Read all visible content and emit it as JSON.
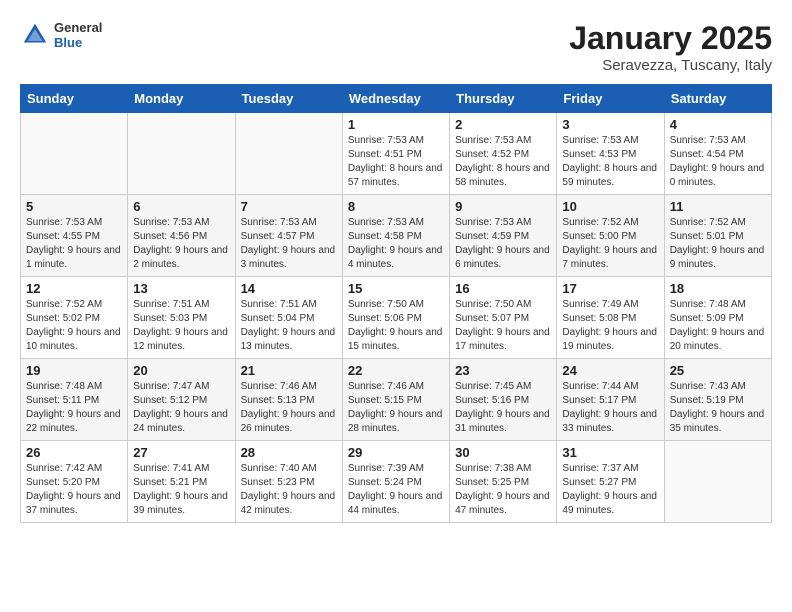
{
  "header": {
    "logo": {
      "general": "General",
      "blue": "Blue"
    },
    "title": "January 2025",
    "location": "Seravezza, Tuscany, Italy"
  },
  "weekdays": [
    "Sunday",
    "Monday",
    "Tuesday",
    "Wednesday",
    "Thursday",
    "Friday",
    "Saturday"
  ],
  "weeks": [
    [
      {
        "day": "",
        "info": ""
      },
      {
        "day": "",
        "info": ""
      },
      {
        "day": "",
        "info": ""
      },
      {
        "day": "1",
        "info": "Sunrise: 7:53 AM\nSunset: 4:51 PM\nDaylight: 8 hours\nand 57 minutes."
      },
      {
        "day": "2",
        "info": "Sunrise: 7:53 AM\nSunset: 4:52 PM\nDaylight: 8 hours\nand 58 minutes."
      },
      {
        "day": "3",
        "info": "Sunrise: 7:53 AM\nSunset: 4:53 PM\nDaylight: 8 hours\nand 59 minutes."
      },
      {
        "day": "4",
        "info": "Sunrise: 7:53 AM\nSunset: 4:54 PM\nDaylight: 9 hours\nand 0 minutes."
      }
    ],
    [
      {
        "day": "5",
        "info": "Sunrise: 7:53 AM\nSunset: 4:55 PM\nDaylight: 9 hours\nand 1 minute."
      },
      {
        "day": "6",
        "info": "Sunrise: 7:53 AM\nSunset: 4:56 PM\nDaylight: 9 hours\nand 2 minutes."
      },
      {
        "day": "7",
        "info": "Sunrise: 7:53 AM\nSunset: 4:57 PM\nDaylight: 9 hours\nand 3 minutes."
      },
      {
        "day": "8",
        "info": "Sunrise: 7:53 AM\nSunset: 4:58 PM\nDaylight: 9 hours\nand 4 minutes."
      },
      {
        "day": "9",
        "info": "Sunrise: 7:53 AM\nSunset: 4:59 PM\nDaylight: 9 hours\nand 6 minutes."
      },
      {
        "day": "10",
        "info": "Sunrise: 7:52 AM\nSunset: 5:00 PM\nDaylight: 9 hours\nand 7 minutes."
      },
      {
        "day": "11",
        "info": "Sunrise: 7:52 AM\nSunset: 5:01 PM\nDaylight: 9 hours\nand 9 minutes."
      }
    ],
    [
      {
        "day": "12",
        "info": "Sunrise: 7:52 AM\nSunset: 5:02 PM\nDaylight: 9 hours\nand 10 minutes."
      },
      {
        "day": "13",
        "info": "Sunrise: 7:51 AM\nSunset: 5:03 PM\nDaylight: 9 hours\nand 12 minutes."
      },
      {
        "day": "14",
        "info": "Sunrise: 7:51 AM\nSunset: 5:04 PM\nDaylight: 9 hours\nand 13 minutes."
      },
      {
        "day": "15",
        "info": "Sunrise: 7:50 AM\nSunset: 5:06 PM\nDaylight: 9 hours\nand 15 minutes."
      },
      {
        "day": "16",
        "info": "Sunrise: 7:50 AM\nSunset: 5:07 PM\nDaylight: 9 hours\nand 17 minutes."
      },
      {
        "day": "17",
        "info": "Sunrise: 7:49 AM\nSunset: 5:08 PM\nDaylight: 9 hours\nand 19 minutes."
      },
      {
        "day": "18",
        "info": "Sunrise: 7:48 AM\nSunset: 5:09 PM\nDaylight: 9 hours\nand 20 minutes."
      }
    ],
    [
      {
        "day": "19",
        "info": "Sunrise: 7:48 AM\nSunset: 5:11 PM\nDaylight: 9 hours\nand 22 minutes."
      },
      {
        "day": "20",
        "info": "Sunrise: 7:47 AM\nSunset: 5:12 PM\nDaylight: 9 hours\nand 24 minutes."
      },
      {
        "day": "21",
        "info": "Sunrise: 7:46 AM\nSunset: 5:13 PM\nDaylight: 9 hours\nand 26 minutes."
      },
      {
        "day": "22",
        "info": "Sunrise: 7:46 AM\nSunset: 5:15 PM\nDaylight: 9 hours\nand 28 minutes."
      },
      {
        "day": "23",
        "info": "Sunrise: 7:45 AM\nSunset: 5:16 PM\nDaylight: 9 hours\nand 31 minutes."
      },
      {
        "day": "24",
        "info": "Sunrise: 7:44 AM\nSunset: 5:17 PM\nDaylight: 9 hours\nand 33 minutes."
      },
      {
        "day": "25",
        "info": "Sunrise: 7:43 AM\nSunset: 5:19 PM\nDaylight: 9 hours\nand 35 minutes."
      }
    ],
    [
      {
        "day": "26",
        "info": "Sunrise: 7:42 AM\nSunset: 5:20 PM\nDaylight: 9 hours\nand 37 minutes."
      },
      {
        "day": "27",
        "info": "Sunrise: 7:41 AM\nSunset: 5:21 PM\nDaylight: 9 hours\nand 39 minutes."
      },
      {
        "day": "28",
        "info": "Sunrise: 7:40 AM\nSunset: 5:23 PM\nDaylight: 9 hours\nand 42 minutes."
      },
      {
        "day": "29",
        "info": "Sunrise: 7:39 AM\nSunset: 5:24 PM\nDaylight: 9 hours\nand 44 minutes."
      },
      {
        "day": "30",
        "info": "Sunrise: 7:38 AM\nSunset: 5:25 PM\nDaylight: 9 hours\nand 47 minutes."
      },
      {
        "day": "31",
        "info": "Sunrise: 7:37 AM\nSunset: 5:27 PM\nDaylight: 9 hours\nand 49 minutes."
      },
      {
        "day": "",
        "info": ""
      }
    ]
  ]
}
